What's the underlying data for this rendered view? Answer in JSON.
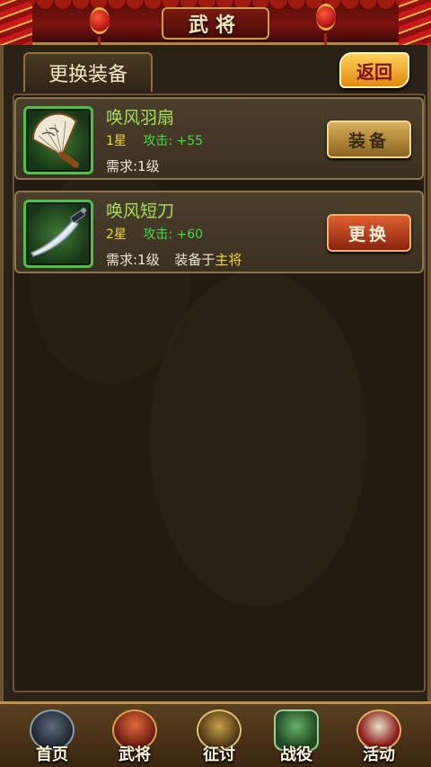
{
  "header": {
    "title": "武将"
  },
  "tabs": {
    "active": "更换装备"
  },
  "back_label": "返回",
  "items": [
    {
      "name": "唤风羽扇",
      "stars": "1星",
      "attack_label": "攻击:",
      "attack_value": "+55",
      "requirement": "需求:1级",
      "equipped_on_label": "",
      "equipped_on_name": "",
      "button_label": "装备",
      "icon": "feather-fan-icon"
    },
    {
      "name": "唤风短刀",
      "stars": "2星",
      "attack_label": "攻击:",
      "attack_value": "+60",
      "requirement": "需求:1级",
      "equipped_on_label": "装备于",
      "equipped_on_name": "主将",
      "button_label": "更换",
      "icon": "dagger-icon"
    }
  ],
  "nav": [
    {
      "label": "首页",
      "icon": "home-icon"
    },
    {
      "label": "武将",
      "icon": "general-icon"
    },
    {
      "label": "征讨",
      "icon": "campaign-icon"
    },
    {
      "label": "战役",
      "icon": "battle-icon"
    },
    {
      "label": "活动",
      "icon": "event-icon"
    }
  ],
  "colors": {
    "item_name": "#a7dd5a",
    "stars": "#f3d43a",
    "attack": "#4fd34a",
    "highlight": "#f3d43a"
  }
}
